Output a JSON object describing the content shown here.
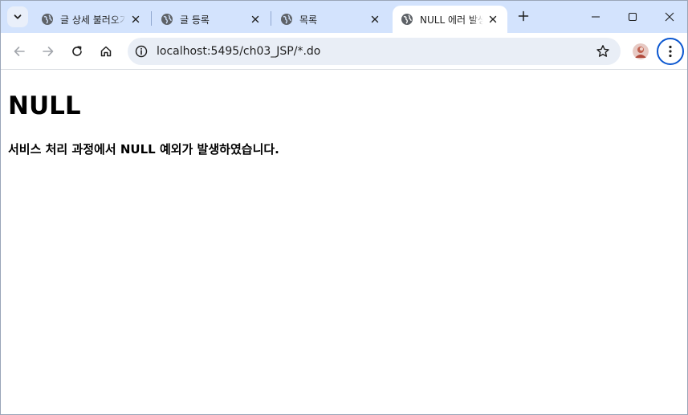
{
  "browser": {
    "tabs": [
      {
        "title": "글 상세 불러오기",
        "active": false
      },
      {
        "title": "글 등록",
        "active": false
      },
      {
        "title": "목록",
        "active": false
      },
      {
        "title": "NULL 에러 발생",
        "active": true
      }
    ],
    "address_bar": {
      "url": "localhost:5495/ch03_JSP/*.do"
    },
    "icons": {
      "tab_search": "chevron-down-icon",
      "favicon": "globe-icon",
      "close": "close-icon",
      "new_tab": "plus-icon",
      "minimize": "minimize-icon",
      "maximize": "maximize-icon",
      "window_close": "close-icon",
      "back": "arrow-left-icon",
      "forward": "arrow-right-icon",
      "reload": "reload-icon",
      "home": "home-icon",
      "site_info": "info-icon",
      "bookmark": "star-icon",
      "profile": "avatar",
      "menu": "more-vert-icon"
    },
    "colors": {
      "tabstrip_bg": "#d3e3fd",
      "omnibox_bg": "#e9eef6",
      "accent": "#0b57d0"
    }
  },
  "page": {
    "heading": "NULL",
    "message": "서비스 처리 과정에서 NULL 예외가 발생하였습니다."
  }
}
